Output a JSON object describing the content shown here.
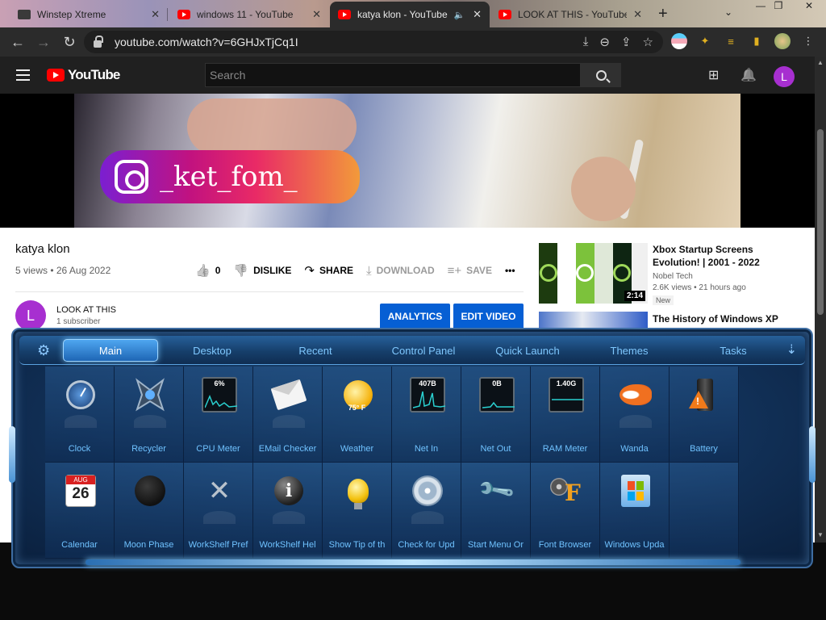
{
  "browser": {
    "tabs": [
      {
        "title": "Winstep Xtreme",
        "icon": "winstep-icon",
        "active": false
      },
      {
        "title": "windows 11 - YouTube",
        "icon": "youtube-icon",
        "active": false
      },
      {
        "title": "katya klon - YouTube",
        "icon": "youtube-icon",
        "active": true,
        "audio_icon": "🔈"
      },
      {
        "title": "LOOK AT THIS - YouTube",
        "icon": "youtube-icon",
        "active": false
      }
    ],
    "close_glyph": "✕",
    "new_tab_glyph": "+",
    "tab_menu_glyph": "⌄",
    "window_controls": {
      "minimize": "—",
      "restore": "❐",
      "close": "✕"
    },
    "back_glyph": "←",
    "forward_glyph": "→",
    "reload_glyph": "↻",
    "url": "youtube.com/watch?v=6GHJxTjCq1I",
    "omni_icons": {
      "install": "⤓",
      "zoom": "⊖",
      "share": "⇪",
      "bookmark": "☆"
    },
    "ext_icons": {
      "puzzle": "✦",
      "media": "≡",
      "sidebar": "▮"
    }
  },
  "youtube": {
    "logo_text": "YouTube",
    "search_placeholder": "Search",
    "create_icon": "⊞",
    "bell_icon": "🔔",
    "avatar_letter": "L",
    "instagram_handle": "_ket_fom_",
    "video": {
      "title": "katya klon",
      "meta": "5 views • 26 Aug 2022",
      "like_count": "0",
      "actions": {
        "dislike": "DISLIKE",
        "share": "SHARE",
        "download": "DOWNLOAD",
        "save": "SAVE",
        "more": "•••"
      },
      "action_icons": {
        "like": "👍",
        "dislike": "👎",
        "share": "↷",
        "download": "⤓",
        "save": "≡+"
      }
    },
    "channel": {
      "avatar_letter": "L",
      "name": "LOOK AT THIS",
      "subscribers": "1 subscriber"
    },
    "buttons": {
      "analytics": "ANALYTICS",
      "edit_video": "EDIT VIDEO"
    },
    "related": [
      {
        "title": "Xbox Startup Screens Evolution! | 2001 - 2022",
        "channel": "Nobel Tech",
        "stats": "2.6K views • 21 hours ago",
        "badge": "New",
        "duration": "2:14"
      },
      {
        "title": "The History of Windows XP"
      }
    ],
    "scroll_up": "▲",
    "scroll_down": "▼"
  },
  "workshelf": {
    "settings_icon": "⚙",
    "pin_icon": "⇣",
    "tabs": [
      "Main",
      "Desktop",
      "Recent",
      "Control Panel",
      "Quick Launch",
      "Themes",
      "Tasks"
    ],
    "active_tab": "Main",
    "items": [
      {
        "label": "Clock",
        "icon": "clock-icon"
      },
      {
        "label": "Recycler",
        "icon": "recycler-icon"
      },
      {
        "label": "CPU Meter",
        "icon": "cpu-meter-icon",
        "value": "6%"
      },
      {
        "label": "EMail Checker",
        "icon": "email-icon"
      },
      {
        "label": "Weather",
        "icon": "weather-icon",
        "value": "75° F"
      },
      {
        "label": "Net In",
        "icon": "net-in-icon",
        "value": "407B"
      },
      {
        "label": "Net Out",
        "icon": "net-out-icon",
        "value": "0B"
      },
      {
        "label": "RAM Meter",
        "icon": "ram-meter-icon",
        "value": "1.40G"
      },
      {
        "label": "Wanda",
        "icon": "fish-icon"
      },
      {
        "label": "Battery",
        "icon": "battery-icon"
      },
      {
        "label": "Calendar",
        "icon": "calendar-icon",
        "month": "AUG",
        "day": "26"
      },
      {
        "label": "Moon Phase",
        "icon": "moon-icon"
      },
      {
        "label": "WorkShelf Pref",
        "icon": "tools-icon"
      },
      {
        "label": "WorkShelf Hel",
        "icon": "info-icon"
      },
      {
        "label": "Show Tip of th",
        "icon": "bulb-icon"
      },
      {
        "label": "Check for Upd",
        "icon": "update-disc-icon"
      },
      {
        "label": "Start Menu Or",
        "icon": "wrench-icon"
      },
      {
        "label": "Font Browser",
        "icon": "font-icon"
      },
      {
        "label": "Windows Upda",
        "icon": "windows-update-icon"
      },
      {
        "label": "",
        "icon": ""
      }
    ]
  },
  "colors": {
    "youtube_red": "#ff0000",
    "avatar_purple": "#a72fd0",
    "button_blue": "#065fd4",
    "shelf_text": "#6fc2ff"
  }
}
